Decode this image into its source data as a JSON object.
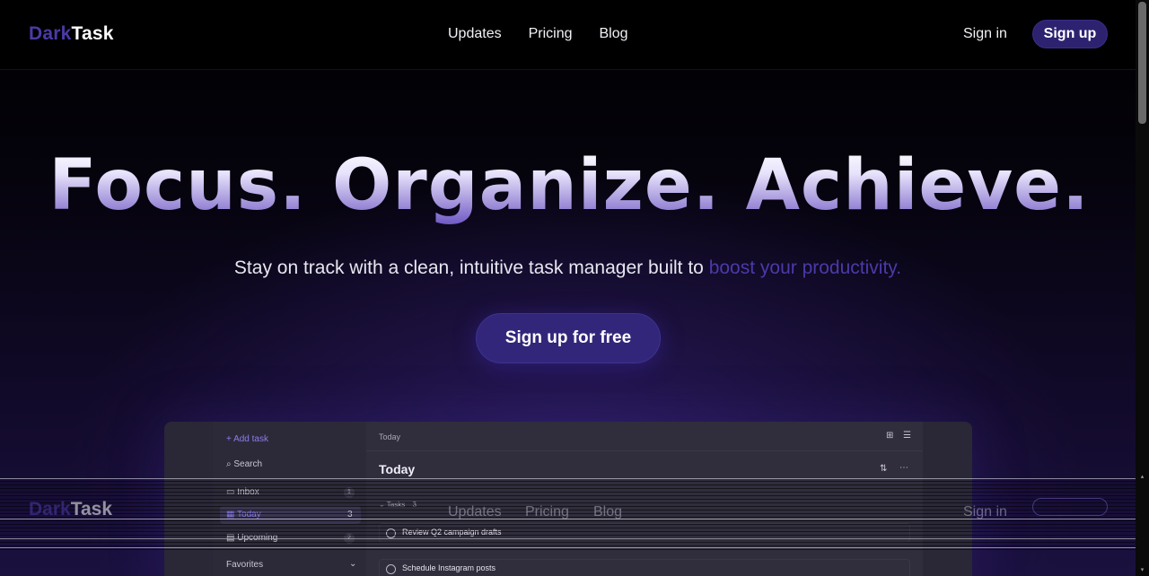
{
  "nav": {
    "logo_dark": "Dark",
    "logo_task": "Task",
    "links": [
      "Updates",
      "Pricing",
      "Blog"
    ],
    "sign_in": "Sign in",
    "sign_up": "Sign up"
  },
  "hero": {
    "title": "Focus. Organize. Achieve.",
    "subtitle_main": "Stay on track with a clean, intuitive task manager built to ",
    "subtitle_accent": "boost your productivity.",
    "cta": "Sign up for free"
  },
  "preview": {
    "add_task": "+ Add task",
    "search": "Search",
    "inbox": "Inbox",
    "inbox_count": "1",
    "today": "Today",
    "today_count": "3",
    "upcoming": "Upcoming",
    "upcoming_count": "2",
    "favorites": "Favorites",
    "breadcrumb": "Today",
    "title": "Today",
    "section": "Tasks",
    "section_count": "3",
    "tasks": [
      "Review Q2 campaign drafts",
      "Schedule Instagram posts"
    ]
  },
  "colors": {
    "accent": "#4b3aa8",
    "button": "#2d2270",
    "background": "#000000"
  }
}
